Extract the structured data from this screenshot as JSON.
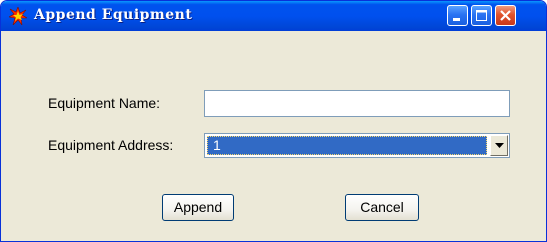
{
  "window": {
    "title": "Append Equipment",
    "title_icon": "explosion-star-icon",
    "controls": [
      "minimize-icon",
      "maximize-icon",
      "close-icon"
    ]
  },
  "form": {
    "name_label": "Equipment Name:",
    "name_value": "",
    "address_label": "Equipment Address:",
    "address_selected": "1"
  },
  "buttons": {
    "append_label": "Append",
    "cancel_label": "Cancel"
  },
  "colors": {
    "titlebar": "#0053ee",
    "dialog_bg": "#ece9d8",
    "selection": "#316ac5",
    "close_button": "#e0532d"
  }
}
